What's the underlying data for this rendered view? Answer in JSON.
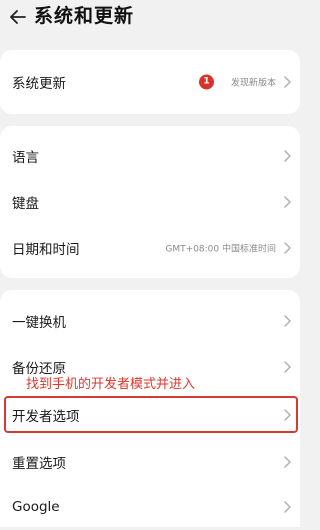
{
  "header": {
    "title": "系统和更新",
    "back_icon": "arrow-left-icon"
  },
  "group1": {
    "system_update": {
      "label": "系统更新",
      "badge": "1",
      "badge_color": "#d9322d",
      "value": "发现新版本"
    }
  },
  "group2": {
    "items": [
      {
        "label": "语言",
        "value": ""
      },
      {
        "label": "键盘",
        "value": ""
      },
      {
        "label": "日期和时间",
        "value": "GMT+08:00 中国标准时间"
      }
    ]
  },
  "group3": {
    "items": [
      {
        "label": "一键换机"
      },
      {
        "label": "备份还原"
      },
      {
        "label": "开发者选项"
      },
      {
        "label": "重置选项"
      },
      {
        "label": "Google"
      }
    ]
  },
  "annotation": {
    "text": "找到手机的开发者模式并进入",
    "color": "#d93a2e"
  },
  "icons": {
    "chevron": "chevron-right-icon"
  }
}
